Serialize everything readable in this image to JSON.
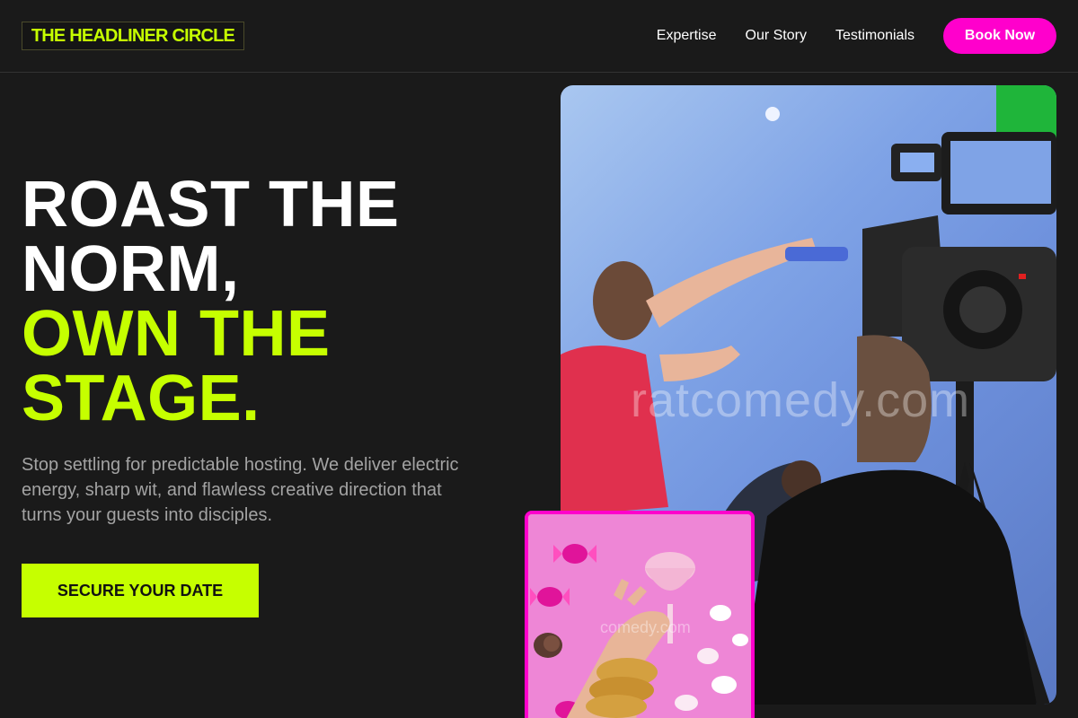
{
  "header": {
    "logo_text": "THE HEADLINER CIRCLE",
    "nav": [
      {
        "label": "Expertise"
      },
      {
        "label": "Our Story"
      },
      {
        "label": "Testimonials"
      }
    ],
    "cta_label": "Book Now"
  },
  "hero": {
    "headline_line1": "ROAST THE",
    "headline_line2": "NORM,",
    "headline_line3": "OWN THE",
    "headline_line4": "STAGE.",
    "subtext": "Stop settling for predictable hosting. We deliver electric energy, sharp wit, and flawless creative direction that turns your guests into disciples.",
    "cta_label": "SECURE YOUR DATE",
    "main_image_watermark": "ratcomedy.com",
    "inset_image_watermark": "comedy.com"
  },
  "colors": {
    "background": "#1a1a1a",
    "accent_lime": "#c6ff00",
    "accent_magenta": "#ff00cc",
    "muted_text": "#a3a3a3"
  }
}
